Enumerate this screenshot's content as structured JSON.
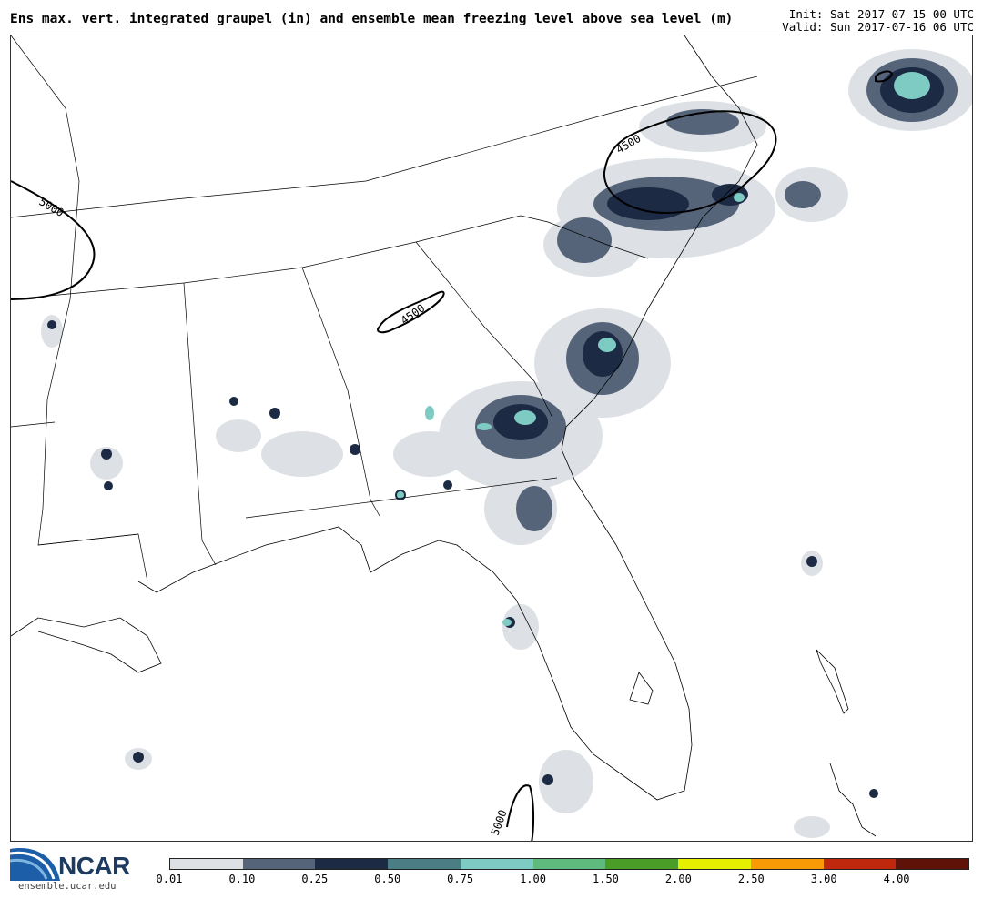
{
  "header": {
    "title": "Ens max. vert. integrated graupel (in) and ensemble mean freezing level above sea level (m)",
    "init": "Init: Sat 2017-07-15 00 UTC",
    "valid": "Valid: Sun 2017-07-16 06 UTC"
  },
  "map": {
    "contour_labels": [
      "5000",
      "4500",
      "4500",
      "5000"
    ],
    "colors": {
      "coast": "#000000",
      "border": "#000000",
      "contour": "#000000"
    }
  },
  "colorbar": {
    "colors": [
      "#dde1e5",
      "#56647a",
      "#1c2a44",
      "#4a7d84",
      "#7ecbc4",
      "#5fba7d",
      "#4a9e28",
      "#e6ef00",
      "#f79a06",
      "#c0280e",
      "#5e1208"
    ],
    "tick_labels": [
      "0.01",
      "0.10",
      "0.25",
      "0.50",
      "0.75",
      "1.00",
      "1.50",
      "2.00",
      "2.50",
      "3.00",
      "4.00"
    ]
  },
  "logo": {
    "name": "NCAR",
    "url": "ensemble.ucar.edu"
  }
}
